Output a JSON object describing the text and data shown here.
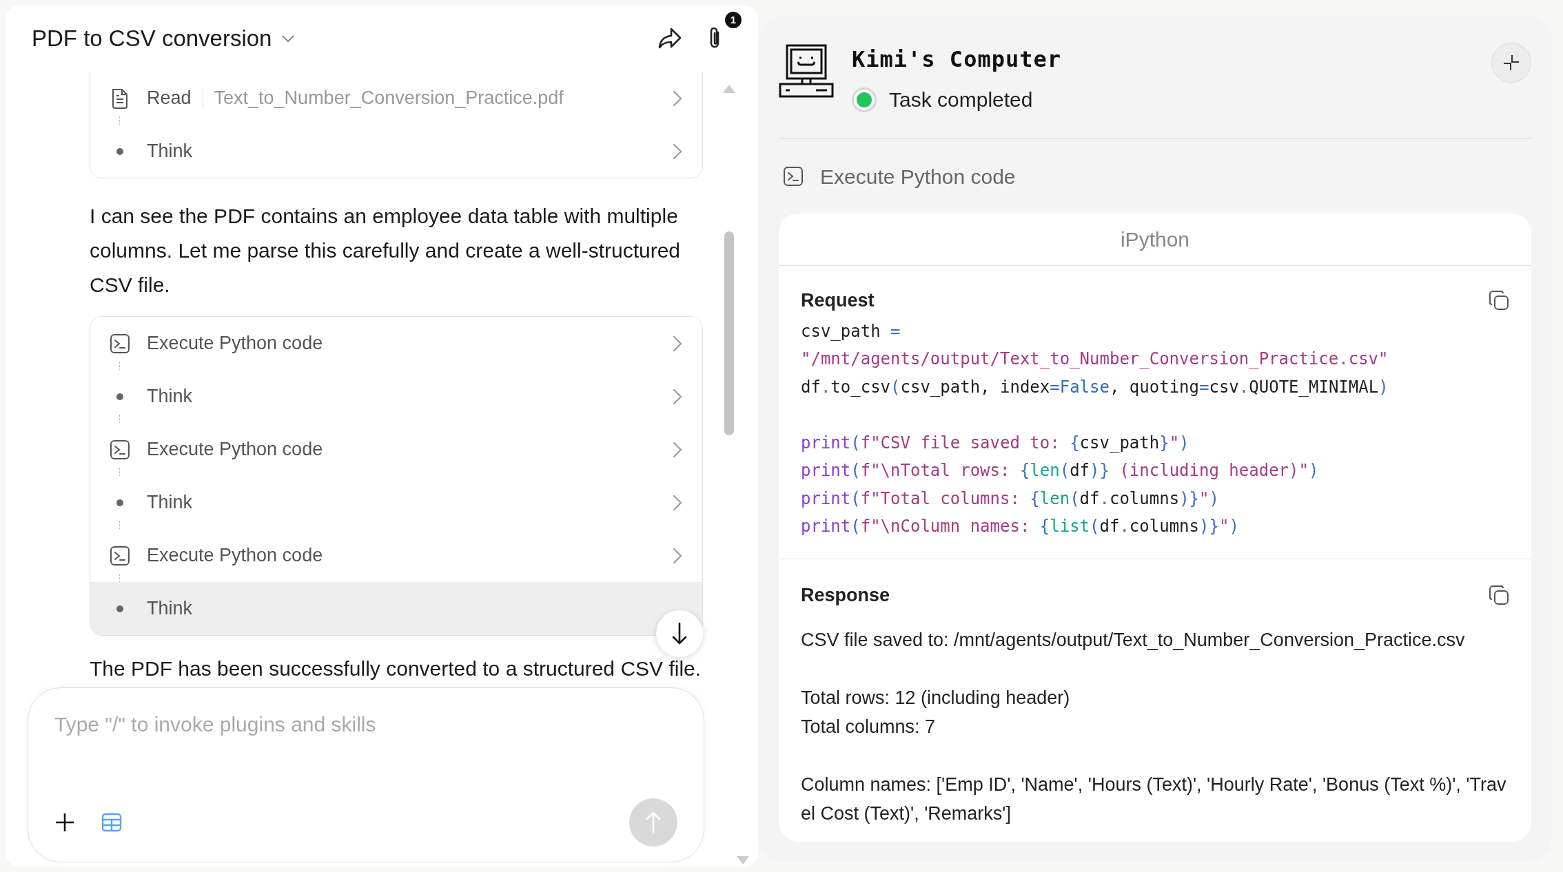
{
  "chat": {
    "title": "PDF to CSV conversion",
    "attachment_count": "1",
    "steps_top": [
      {
        "kind": "read",
        "label": "Read",
        "file": "Text_to_Number_Conversion_Practice.pdf"
      },
      {
        "kind": "think",
        "label": "Think"
      }
    ],
    "message": "I can see the PDF contains an employee data table with multiple columns. Let me parse this carefully and create a well-structured CSV file.",
    "steps": [
      {
        "kind": "code",
        "label": "Execute Python code",
        "selected": false
      },
      {
        "kind": "think",
        "label": "Think",
        "selected": false
      },
      {
        "kind": "code",
        "label": "Execute Python code",
        "selected": false
      },
      {
        "kind": "think",
        "label": "Think",
        "selected": false
      },
      {
        "kind": "code",
        "label": "Execute Python code",
        "selected": false
      },
      {
        "kind": "think",
        "label": "Think",
        "selected": true
      }
    ],
    "closing": "The PDF has been successfully converted to a structured CSV file.",
    "input": {
      "placeholder": "Type \"/\" to invoke plugins and skills"
    }
  },
  "computer": {
    "title": "Kimi's Computer",
    "status": "Task completed",
    "completed": true,
    "tool": "Execute Python code",
    "tab": "iPython",
    "request_label": "Request",
    "code_blocks": [
      {
        "lines": [
          {
            "tokens": [
              {
                "kind": "name",
                "text": "csv_path "
              },
              {
                "kind": "op",
                "text": "="
              }
            ]
          },
          {
            "tokens": [
              {
                "kind": "string",
                "text": "\"/mnt/agents/output/Text_to_Number_Conversion_Practice.csv\""
              }
            ]
          },
          {
            "tokens": [
              {
                "kind": "name",
                "text": "df"
              },
              {
                "kind": "op",
                "text": "."
              },
              {
                "kind": "name",
                "text": "to_csv"
              },
              {
                "kind": "op",
                "text": "("
              },
              {
                "kind": "name",
                "text": "csv_path, index"
              },
              {
                "kind": "op",
                "text": "="
              },
              {
                "kind": "keyword",
                "text": "False"
              },
              {
                "kind": "name",
                "text": ", quoting"
              },
              {
                "kind": "op",
                "text": "="
              },
              {
                "kind": "name",
                "text": "csv"
              },
              {
                "kind": "op",
                "text": "."
              },
              {
                "kind": "name",
                "text": "QUOTE_MINIMAL"
              },
              {
                "kind": "op",
                "text": ")"
              }
            ]
          }
        ]
      },
      {
        "lines": [
          {
            "tokens": [
              {
                "kind": "func",
                "text": "print"
              },
              {
                "kind": "op",
                "text": "("
              },
              {
                "kind": "string",
                "text": "f\"CSV file saved to: "
              },
              {
                "kind": "op",
                "text": "{"
              },
              {
                "kind": "name",
                "text": "csv_path"
              },
              {
                "kind": "op",
                "text": "}"
              },
              {
                "kind": "string",
                "text": "\""
              },
              {
                "kind": "op",
                "text": ")"
              }
            ]
          },
          {
            "tokens": [
              {
                "kind": "func",
                "text": "print"
              },
              {
                "kind": "op",
                "text": "("
              },
              {
                "kind": "string",
                "text": "f\"\\nTotal rows: "
              },
              {
                "kind": "op",
                "text": "{"
              },
              {
                "kind": "builtin",
                "text": "len"
              },
              {
                "kind": "op",
                "text": "("
              },
              {
                "kind": "name",
                "text": "df"
              },
              {
                "kind": "op",
                "text": ")}"
              },
              {
                "kind": "string",
                "text": " (including header)\""
              },
              {
                "kind": "op",
                "text": ")"
              }
            ]
          },
          {
            "tokens": [
              {
                "kind": "func",
                "text": "print"
              },
              {
                "kind": "op",
                "text": "("
              },
              {
                "kind": "string",
                "text": "f\"Total columns: "
              },
              {
                "kind": "op",
                "text": "{"
              },
              {
                "kind": "builtin",
                "text": "len"
              },
              {
                "kind": "op",
                "text": "("
              },
              {
                "kind": "name",
                "text": "df"
              },
              {
                "kind": "op",
                "text": "."
              },
              {
                "kind": "name",
                "text": "columns"
              },
              {
                "kind": "op",
                "text": ")}"
              },
              {
                "kind": "string",
                "text": "\""
              },
              {
                "kind": "op",
                "text": ")"
              }
            ]
          },
          {
            "tokens": [
              {
                "kind": "func",
                "text": "print"
              },
              {
                "kind": "op",
                "text": "("
              },
              {
                "kind": "string",
                "text": "f\"\\nColumn names: "
              },
              {
                "kind": "op",
                "text": "{"
              },
              {
                "kind": "builtin",
                "text": "list"
              },
              {
                "kind": "op",
                "text": "("
              },
              {
                "kind": "name",
                "text": "df"
              },
              {
                "kind": "op",
                "text": "."
              },
              {
                "kind": "name",
                "text": "columns"
              },
              {
                "kind": "op",
                "text": ")}"
              },
              {
                "kind": "string",
                "text": "\""
              },
              {
                "kind": "op",
                "text": ")"
              }
            ]
          }
        ]
      }
    ],
    "response_label": "Response",
    "response_paragraphs": [
      [
        "CSV file saved to: /mnt/agents/output/Text_to_Number_Conversion_Practice.csv"
      ],
      [
        "Total rows: 12 (including header)",
        "Total columns: 7"
      ],
      [
        "Column names: ['Emp ID', 'Name', 'Hours (Text)', 'Hourly Rate', 'Bonus (Text %)', 'Travel Cost (Text)', 'Remarks']"
      ]
    ]
  }
}
